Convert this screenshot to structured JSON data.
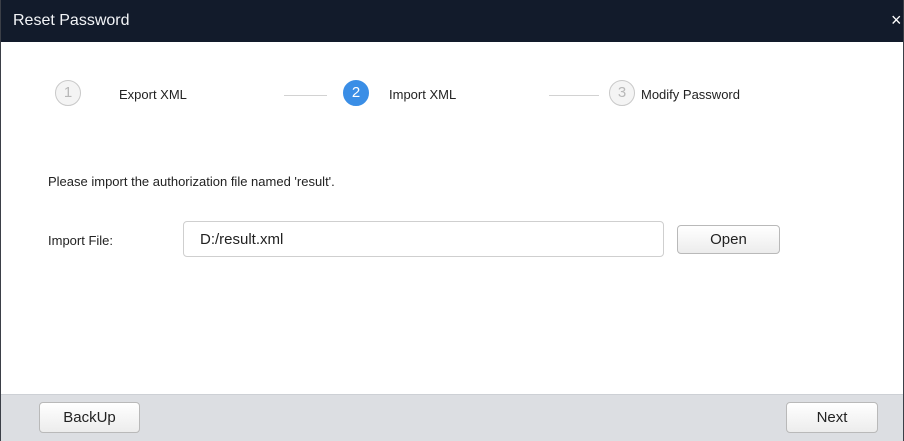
{
  "window": {
    "title": "Reset Password",
    "close_glyph": "×"
  },
  "steps": [
    {
      "number": "1",
      "label": "Export XML",
      "state": "inactive"
    },
    {
      "number": "2",
      "label": "Import XML",
      "state": "active"
    },
    {
      "number": "3",
      "label": "Modify Password",
      "state": "inactive"
    }
  ],
  "content": {
    "instruction": "Please import the authorization file named 'result'.",
    "import_label": "Import File:",
    "import_value": "D:/result.xml",
    "open_label": "Open"
  },
  "footer": {
    "back_label": "BackUp",
    "next_label": "Next"
  },
  "colors": {
    "titlebar": "#121b2b",
    "active_step": "#3a8ee6",
    "footer": "#dcdee2"
  }
}
